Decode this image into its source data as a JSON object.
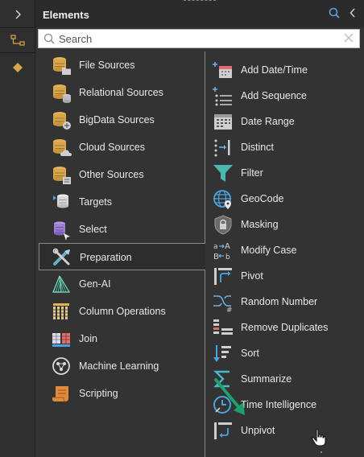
{
  "panel": {
    "title": "Elements"
  },
  "search": {
    "placeholder": "Search"
  },
  "left_items": [
    {
      "label": "File Sources",
      "icon": "db-folder-icon"
    },
    {
      "label": "Relational Sources",
      "icon": "db-stack-icon"
    },
    {
      "label": "BigData Sources",
      "icon": "db-bigdata-icon"
    },
    {
      "label": "Cloud Sources",
      "icon": "db-cloud-icon"
    },
    {
      "label": "Other Sources",
      "icon": "db-other-icon"
    },
    {
      "label": "Targets",
      "icon": "target-db-icon"
    },
    {
      "label": "Select",
      "icon": "select-db-icon"
    },
    {
      "label": "Preparation",
      "icon": "preparation-tools-icon",
      "selected": true
    },
    {
      "label": "Gen-AI",
      "icon": "gen-ai-icon"
    },
    {
      "label": "Column Operations",
      "icon": "columns-icon"
    },
    {
      "label": "Join",
      "icon": "join-icon"
    },
    {
      "label": "Machine Learning",
      "icon": "machine-learning-icon"
    },
    {
      "label": "Scripting",
      "icon": "scripting-icon"
    }
  ],
  "right_items": [
    {
      "label": "Add Date/Time",
      "icon": "add-datetime-icon"
    },
    {
      "label": "Add Sequence",
      "icon": "add-sequence-icon"
    },
    {
      "label": "Date Range",
      "icon": "date-range-icon"
    },
    {
      "label": "Distinct",
      "icon": "distinct-icon"
    },
    {
      "label": "Filter",
      "icon": "filter-icon"
    },
    {
      "label": "GeoCode",
      "icon": "geocode-icon"
    },
    {
      "label": "Masking",
      "icon": "masking-icon"
    },
    {
      "label": "Modify Case",
      "icon": "modify-case-icon"
    },
    {
      "label": "Pivot",
      "icon": "pivot-icon"
    },
    {
      "label": "Random Number",
      "icon": "random-number-icon"
    },
    {
      "label": "Remove Duplicates",
      "icon": "remove-duplicates-icon"
    },
    {
      "label": "Sort",
      "icon": "sort-icon"
    },
    {
      "label": "Summarize",
      "icon": "summarize-icon"
    },
    {
      "label": "Time Intelligence",
      "icon": "time-intelligence-icon"
    },
    {
      "label": "Unpivot",
      "icon": "unpivot-icon"
    }
  ],
  "colors": {
    "accent_teal": "#4aa3a8",
    "db_gold": "#d9a64a",
    "arrow_green": "#1f9e6e"
  }
}
